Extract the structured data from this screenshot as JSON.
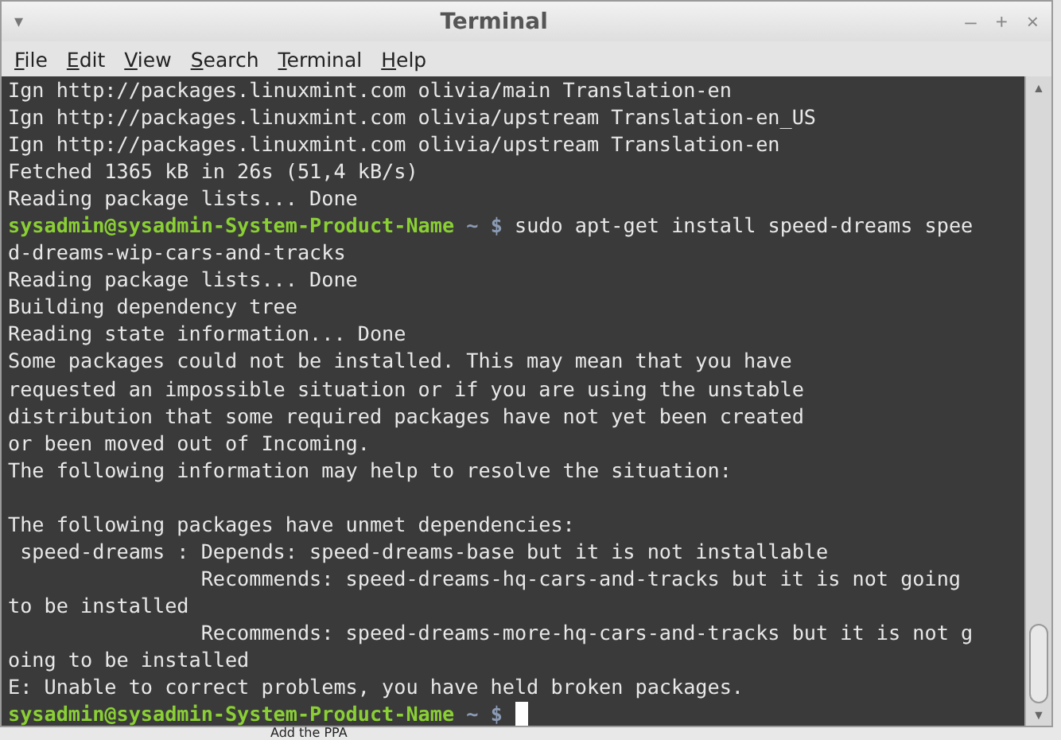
{
  "window": {
    "title": "Terminal",
    "menu_glyph": "▾",
    "controls": [
      "–",
      "+",
      "×"
    ]
  },
  "menu": [
    {
      "label": "File"
    },
    {
      "label": "Edit"
    },
    {
      "label": "View"
    },
    {
      "label": "Search"
    },
    {
      "label": "Terminal"
    },
    {
      "label": "Help"
    }
  ],
  "lines": [
    {
      "kind": "output",
      "text": "Ign http://packages.linuxmint.com olivia/main Translation-en"
    },
    {
      "kind": "output",
      "text": "Ign http://packages.linuxmint.com olivia/upstream Translation-en_US"
    },
    {
      "kind": "output",
      "text": "Ign http://packages.linuxmint.com olivia/upstream Translation-en"
    },
    {
      "kind": "output",
      "text": "Fetched 1365 kB in 26s (51,4 kB/s)"
    },
    {
      "kind": "output",
      "text": "Reading package lists... Done"
    },
    {
      "kind": "prompt",
      "user": "sysadmin@sysadmin-System-Product-Name",
      "path": "~",
      "symbol": "$",
      "command": "sudo apt-get install speed-dreams spee"
    },
    {
      "kind": "output",
      "text": "d-dreams-wip-cars-and-tracks"
    },
    {
      "kind": "output",
      "text": "Reading package lists... Done"
    },
    {
      "kind": "output",
      "text": "Building dependency tree"
    },
    {
      "kind": "output",
      "text": "Reading state information... Done"
    },
    {
      "kind": "output",
      "text": "Some packages could not be installed. This may mean that you have"
    },
    {
      "kind": "output",
      "text": "requested an impossible situation or if you are using the unstable"
    },
    {
      "kind": "output",
      "text": "distribution that some required packages have not yet been created"
    },
    {
      "kind": "output",
      "text": "or been moved out of Incoming."
    },
    {
      "kind": "output",
      "text": "The following information may help to resolve the situation:"
    },
    {
      "kind": "blank"
    },
    {
      "kind": "output",
      "text": "The following packages have unmet dependencies:"
    },
    {
      "kind": "output",
      "text": " speed-dreams : Depends: speed-dreams-base but it is not installable"
    },
    {
      "kind": "output",
      "text": "                Recommends: speed-dreams-hq-cars-and-tracks but it is not going"
    },
    {
      "kind": "output",
      "text": "to be installed"
    },
    {
      "kind": "output",
      "text": "                Recommends: speed-dreams-more-hq-cars-and-tracks but it is not g"
    },
    {
      "kind": "output",
      "text": "oing to be installed"
    },
    {
      "kind": "output",
      "text": "E: Unable to correct problems, you have held broken packages."
    },
    {
      "kind": "prompt",
      "user": "sysadmin@sysadmin-System-Product-Name",
      "path": "~",
      "symbol": "$",
      "cursor": true
    }
  ],
  "scrollbar": {
    "up": "▲",
    "down": "▼"
  },
  "background_text": "Add the PPA"
}
